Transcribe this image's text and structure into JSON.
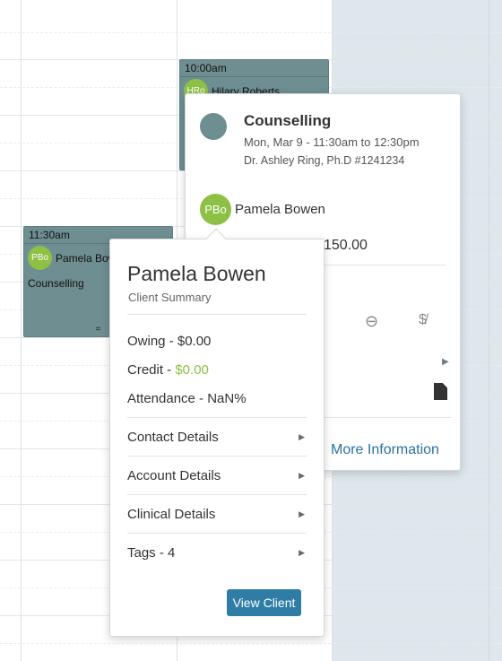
{
  "calendar": {
    "appointments": [
      {
        "time": "10:00am",
        "client_initials": "HRo",
        "client_name": "Hilary Roberts"
      },
      {
        "time": "11:30am",
        "client_initials": "PBo",
        "client_name": "Pamela Bowen",
        "service": "Counselling",
        "grip": "="
      }
    ]
  },
  "appointment_popover": {
    "title": "Counselling",
    "datetime": "Mon, Mar 9 - 11:30am to 12:30pm",
    "provider": "Dr. Ashley Ring, Ph.D #1241234",
    "client_initials": "PBo",
    "client_name": "Pamela Bowen",
    "price": "150.00",
    "more_info_label": "More Information",
    "icons": [
      "calendar-icon",
      "cancel-icon",
      "no-charge-icon",
      "caret-right-icon",
      "document-icon"
    ]
  },
  "client_popover": {
    "name": "Pamela Bowen",
    "subtitle": "Client Summary",
    "owing": "Owing - $0.00",
    "credit_label": "Credit - ",
    "credit_value": "$0.00",
    "attendance": "Attendance - NaN%",
    "sections": [
      "Contact Details",
      "Account Details",
      "Clinical Details",
      "Tags - 4"
    ],
    "view_client_label": "View Client"
  },
  "colors": {
    "appointment_block": "#6e8e92",
    "avatar_green": "#8dc044",
    "primary_button": "#2f7da6",
    "link_blue": "#2a73a0",
    "shaded_column": "#dde7ec"
  }
}
